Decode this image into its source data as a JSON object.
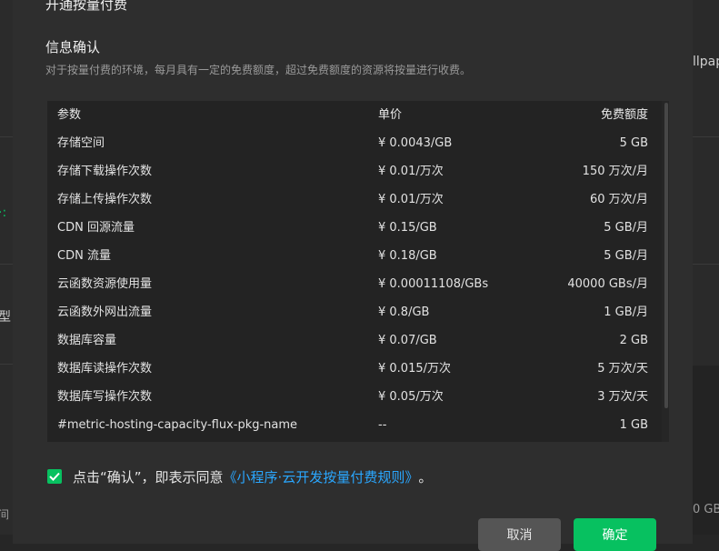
{
  "dialog": {
    "title": "开通按量付费",
    "section_title": "信息确认",
    "section_desc": "对于按量付费的环境，每月具有一定的免费额度，超过免费额度的资源将按量进行收费。"
  },
  "table": {
    "headers": [
      "参数",
      "单价",
      "免费额度"
    ],
    "rows": [
      {
        "param": "存储空间",
        "price": "¥ 0.0043/GB",
        "quota": "5 GB"
      },
      {
        "param": "存储下载操作次数",
        "price": "¥ 0.01/万次",
        "quota": "150 万次/月"
      },
      {
        "param": "存储上传操作次数",
        "price": "¥ 0.01/万次",
        "quota": "60 万次/月"
      },
      {
        "param": "CDN 回源流量",
        "price": "¥ 0.15/GB",
        "quota": "5 GB/月"
      },
      {
        "param": "CDN 流量",
        "price": "¥ 0.18/GB",
        "quota": "5 GB/月"
      },
      {
        "param": "云函数资源使用量",
        "price": "¥ 0.00011108/GBs",
        "quota": "40000 GBs/月"
      },
      {
        "param": "云函数外网出流量",
        "price": "¥ 0.8/GB",
        "quota": "1 GB/月"
      },
      {
        "param": "数据库容量",
        "price": "¥ 0.07/GB",
        "quota": "2 GB"
      },
      {
        "param": "数据库读操作次数",
        "price": "¥ 0.015/万次",
        "quota": "5 万次/天"
      },
      {
        "param": "数据库写操作次数",
        "price": "¥ 0.05/万次",
        "quota": "3 万次/天"
      },
      {
        "param": "#metric-hosting-capacity-flux-pkg-name",
        "price": "--",
        "quota": "1 GB"
      }
    ]
  },
  "agreement": {
    "checked": true,
    "text": "点击“确认”，即表示同意",
    "link": "《小程序·云开发按量付费规则》",
    "suffix": "。"
  },
  "buttons": {
    "cancel": "取消",
    "confirm": "确定"
  },
  "background": {
    "right_top_text": "llpap",
    "right_bottom_text": "0 GB",
    "left_fragments": [
      "·:",
      "型",
      "间"
    ]
  },
  "colors": {
    "accent_green": "#07c160",
    "link_blue": "#2aa7ff",
    "dialog_bg": "#2e2e2e"
  },
  "icons": {
    "checkbox": "check-icon"
  }
}
